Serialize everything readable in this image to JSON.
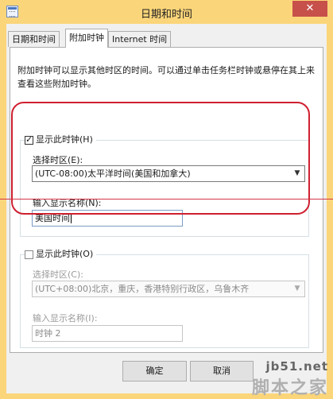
{
  "window": {
    "title": "日期和时间",
    "close_glyph": "✕"
  },
  "tabs": [
    {
      "label": "日期和时间"
    },
    {
      "label": "附加时钟"
    },
    {
      "label": "Internet 时间"
    }
  ],
  "description": "附加时钟可以显示其他时区的时间。可以通过单击任务栏时钟或悬停在其上来查看这些附加时钟。",
  "clock1": {
    "show_label": "显示此时钟(H)",
    "show_checked": true,
    "timezone_label": "选择时区(E):",
    "timezone_value": "(UTC-08:00)太平洋时间(美国和加拿大)",
    "name_label": "输入显示名称(N):",
    "name_value": "美国时间"
  },
  "clock2": {
    "show_label": "显示此时钟(O)",
    "show_checked": false,
    "timezone_label": "选择时区(C):",
    "timezone_value": "(UTC+08:00)北京，重庆，香港特别行政区，乌鲁木齐",
    "name_label": "输入显示名称(I):",
    "name_value": "时钟 2"
  },
  "buttons": {
    "ok": "确定",
    "cancel": "取消"
  },
  "watermark": {
    "site": "jb51.net",
    "cn": "脚本之家"
  },
  "colors": {
    "title_bar": "#fbd579",
    "close_button": "#c7504a",
    "annotation_red": "#cf2030"
  }
}
